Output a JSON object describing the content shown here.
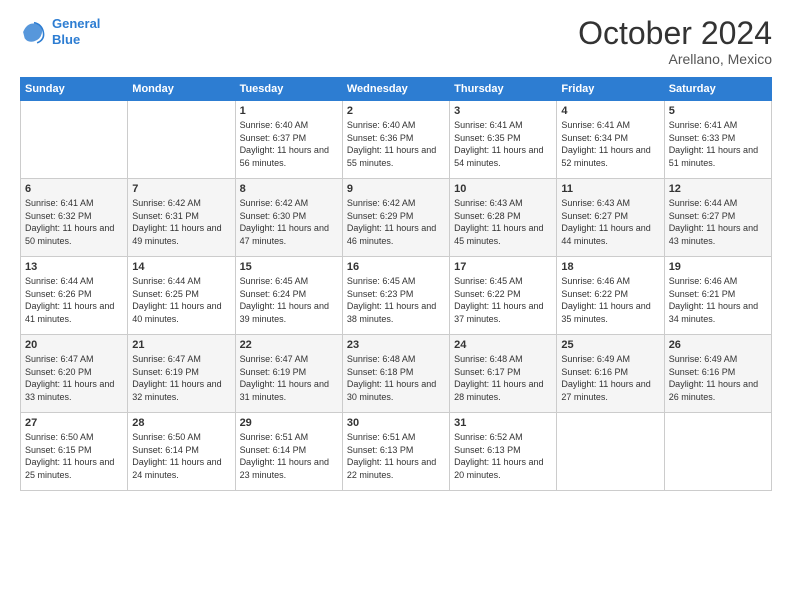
{
  "logo": {
    "line1": "General",
    "line2": "Blue"
  },
  "title": "October 2024",
  "subtitle": "Arellano, Mexico",
  "days_header": [
    "Sunday",
    "Monday",
    "Tuesday",
    "Wednesday",
    "Thursday",
    "Friday",
    "Saturday"
  ],
  "weeks": [
    [
      {
        "day": "",
        "sunrise": "",
        "sunset": "",
        "daylight": ""
      },
      {
        "day": "",
        "sunrise": "",
        "sunset": "",
        "daylight": ""
      },
      {
        "day": "1",
        "sunrise": "Sunrise: 6:40 AM",
        "sunset": "Sunset: 6:37 PM",
        "daylight": "Daylight: 11 hours and 56 minutes."
      },
      {
        "day": "2",
        "sunrise": "Sunrise: 6:40 AM",
        "sunset": "Sunset: 6:36 PM",
        "daylight": "Daylight: 11 hours and 55 minutes."
      },
      {
        "day": "3",
        "sunrise": "Sunrise: 6:41 AM",
        "sunset": "Sunset: 6:35 PM",
        "daylight": "Daylight: 11 hours and 54 minutes."
      },
      {
        "day": "4",
        "sunrise": "Sunrise: 6:41 AM",
        "sunset": "Sunset: 6:34 PM",
        "daylight": "Daylight: 11 hours and 52 minutes."
      },
      {
        "day": "5",
        "sunrise": "Sunrise: 6:41 AM",
        "sunset": "Sunset: 6:33 PM",
        "daylight": "Daylight: 11 hours and 51 minutes."
      }
    ],
    [
      {
        "day": "6",
        "sunrise": "Sunrise: 6:41 AM",
        "sunset": "Sunset: 6:32 PM",
        "daylight": "Daylight: 11 hours and 50 minutes."
      },
      {
        "day": "7",
        "sunrise": "Sunrise: 6:42 AM",
        "sunset": "Sunset: 6:31 PM",
        "daylight": "Daylight: 11 hours and 49 minutes."
      },
      {
        "day": "8",
        "sunrise": "Sunrise: 6:42 AM",
        "sunset": "Sunset: 6:30 PM",
        "daylight": "Daylight: 11 hours and 47 minutes."
      },
      {
        "day": "9",
        "sunrise": "Sunrise: 6:42 AM",
        "sunset": "Sunset: 6:29 PM",
        "daylight": "Daylight: 11 hours and 46 minutes."
      },
      {
        "day": "10",
        "sunrise": "Sunrise: 6:43 AM",
        "sunset": "Sunset: 6:28 PM",
        "daylight": "Daylight: 11 hours and 45 minutes."
      },
      {
        "day": "11",
        "sunrise": "Sunrise: 6:43 AM",
        "sunset": "Sunset: 6:27 PM",
        "daylight": "Daylight: 11 hours and 44 minutes."
      },
      {
        "day": "12",
        "sunrise": "Sunrise: 6:44 AM",
        "sunset": "Sunset: 6:27 PM",
        "daylight": "Daylight: 11 hours and 43 minutes."
      }
    ],
    [
      {
        "day": "13",
        "sunrise": "Sunrise: 6:44 AM",
        "sunset": "Sunset: 6:26 PM",
        "daylight": "Daylight: 11 hours and 41 minutes."
      },
      {
        "day": "14",
        "sunrise": "Sunrise: 6:44 AM",
        "sunset": "Sunset: 6:25 PM",
        "daylight": "Daylight: 11 hours and 40 minutes."
      },
      {
        "day": "15",
        "sunrise": "Sunrise: 6:45 AM",
        "sunset": "Sunset: 6:24 PM",
        "daylight": "Daylight: 11 hours and 39 minutes."
      },
      {
        "day": "16",
        "sunrise": "Sunrise: 6:45 AM",
        "sunset": "Sunset: 6:23 PM",
        "daylight": "Daylight: 11 hours and 38 minutes."
      },
      {
        "day": "17",
        "sunrise": "Sunrise: 6:45 AM",
        "sunset": "Sunset: 6:22 PM",
        "daylight": "Daylight: 11 hours and 37 minutes."
      },
      {
        "day": "18",
        "sunrise": "Sunrise: 6:46 AM",
        "sunset": "Sunset: 6:22 PM",
        "daylight": "Daylight: 11 hours and 35 minutes."
      },
      {
        "day": "19",
        "sunrise": "Sunrise: 6:46 AM",
        "sunset": "Sunset: 6:21 PM",
        "daylight": "Daylight: 11 hours and 34 minutes."
      }
    ],
    [
      {
        "day": "20",
        "sunrise": "Sunrise: 6:47 AM",
        "sunset": "Sunset: 6:20 PM",
        "daylight": "Daylight: 11 hours and 33 minutes."
      },
      {
        "day": "21",
        "sunrise": "Sunrise: 6:47 AM",
        "sunset": "Sunset: 6:19 PM",
        "daylight": "Daylight: 11 hours and 32 minutes."
      },
      {
        "day": "22",
        "sunrise": "Sunrise: 6:47 AM",
        "sunset": "Sunset: 6:19 PM",
        "daylight": "Daylight: 11 hours and 31 minutes."
      },
      {
        "day": "23",
        "sunrise": "Sunrise: 6:48 AM",
        "sunset": "Sunset: 6:18 PM",
        "daylight": "Daylight: 11 hours and 30 minutes."
      },
      {
        "day": "24",
        "sunrise": "Sunrise: 6:48 AM",
        "sunset": "Sunset: 6:17 PM",
        "daylight": "Daylight: 11 hours and 28 minutes."
      },
      {
        "day": "25",
        "sunrise": "Sunrise: 6:49 AM",
        "sunset": "Sunset: 6:16 PM",
        "daylight": "Daylight: 11 hours and 27 minutes."
      },
      {
        "day": "26",
        "sunrise": "Sunrise: 6:49 AM",
        "sunset": "Sunset: 6:16 PM",
        "daylight": "Daylight: 11 hours and 26 minutes."
      }
    ],
    [
      {
        "day": "27",
        "sunrise": "Sunrise: 6:50 AM",
        "sunset": "Sunset: 6:15 PM",
        "daylight": "Daylight: 11 hours and 25 minutes."
      },
      {
        "day": "28",
        "sunrise": "Sunrise: 6:50 AM",
        "sunset": "Sunset: 6:14 PM",
        "daylight": "Daylight: 11 hours and 24 minutes."
      },
      {
        "day": "29",
        "sunrise": "Sunrise: 6:51 AM",
        "sunset": "Sunset: 6:14 PM",
        "daylight": "Daylight: 11 hours and 23 minutes."
      },
      {
        "day": "30",
        "sunrise": "Sunrise: 6:51 AM",
        "sunset": "Sunset: 6:13 PM",
        "daylight": "Daylight: 11 hours and 22 minutes."
      },
      {
        "day": "31",
        "sunrise": "Sunrise: 6:52 AM",
        "sunset": "Sunset: 6:13 PM",
        "daylight": "Daylight: 11 hours and 20 minutes."
      },
      {
        "day": "",
        "sunrise": "",
        "sunset": "",
        "daylight": ""
      },
      {
        "day": "",
        "sunrise": "",
        "sunset": "",
        "daylight": ""
      }
    ]
  ]
}
